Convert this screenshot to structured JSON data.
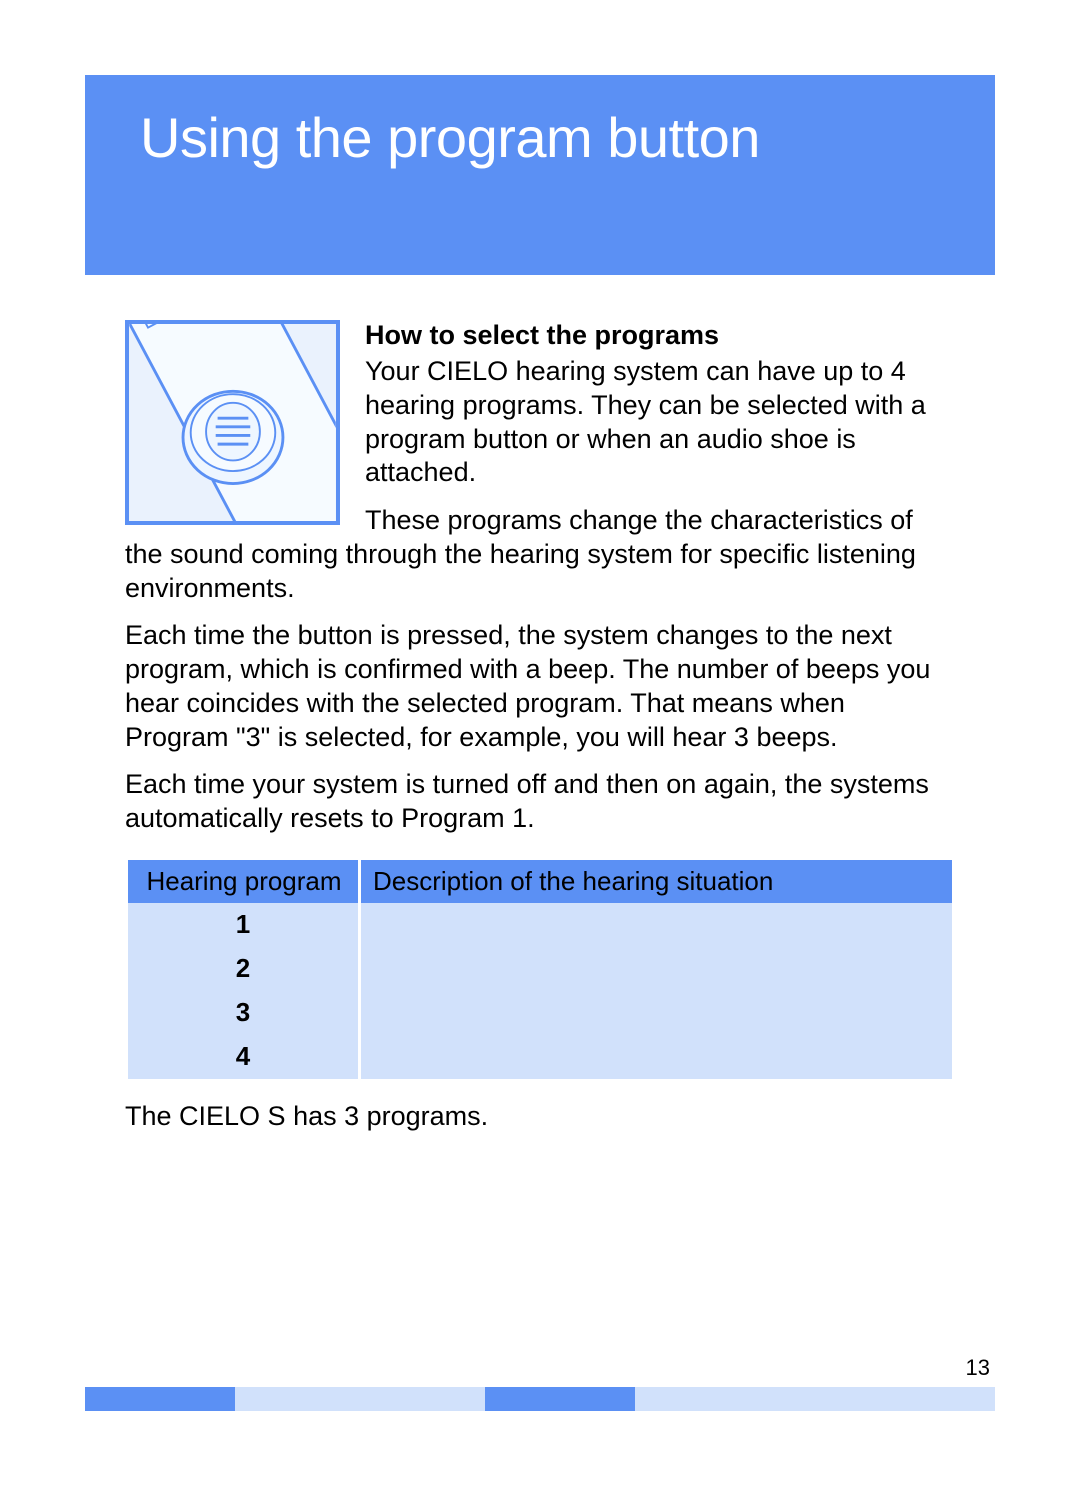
{
  "header": {
    "title": "Using the program button"
  },
  "section": {
    "subheading": "How to select the programs",
    "p1": "Your CIELO hearing system can have up to 4 hearing programs. They can be selected with a program button or when an audio shoe is attached.",
    "p2": "These programs change the characteristics of the sound coming through the hearing system for specific listening environments.",
    "p3": "Each time the button is pressed, the system changes to the next program, which is confirmed with a beep. The number of beeps you hear coincides with the selected program. That means when Program \"3\" is selected, for example, you will hear 3 beeps.",
    "p4": "Each time your system is turned off and then on again, the systems automatically resets to Program 1."
  },
  "table": {
    "headers": {
      "program": "Hearing program",
      "description": "Description of the hearing situation"
    },
    "rows": [
      {
        "program": "1",
        "description": ""
      },
      {
        "program": "2",
        "description": ""
      },
      {
        "program": "3",
        "description": ""
      },
      {
        "program": "4",
        "description": ""
      }
    ]
  },
  "footnote": "The CIELO S has 3 programs.",
  "page_number": "13"
}
